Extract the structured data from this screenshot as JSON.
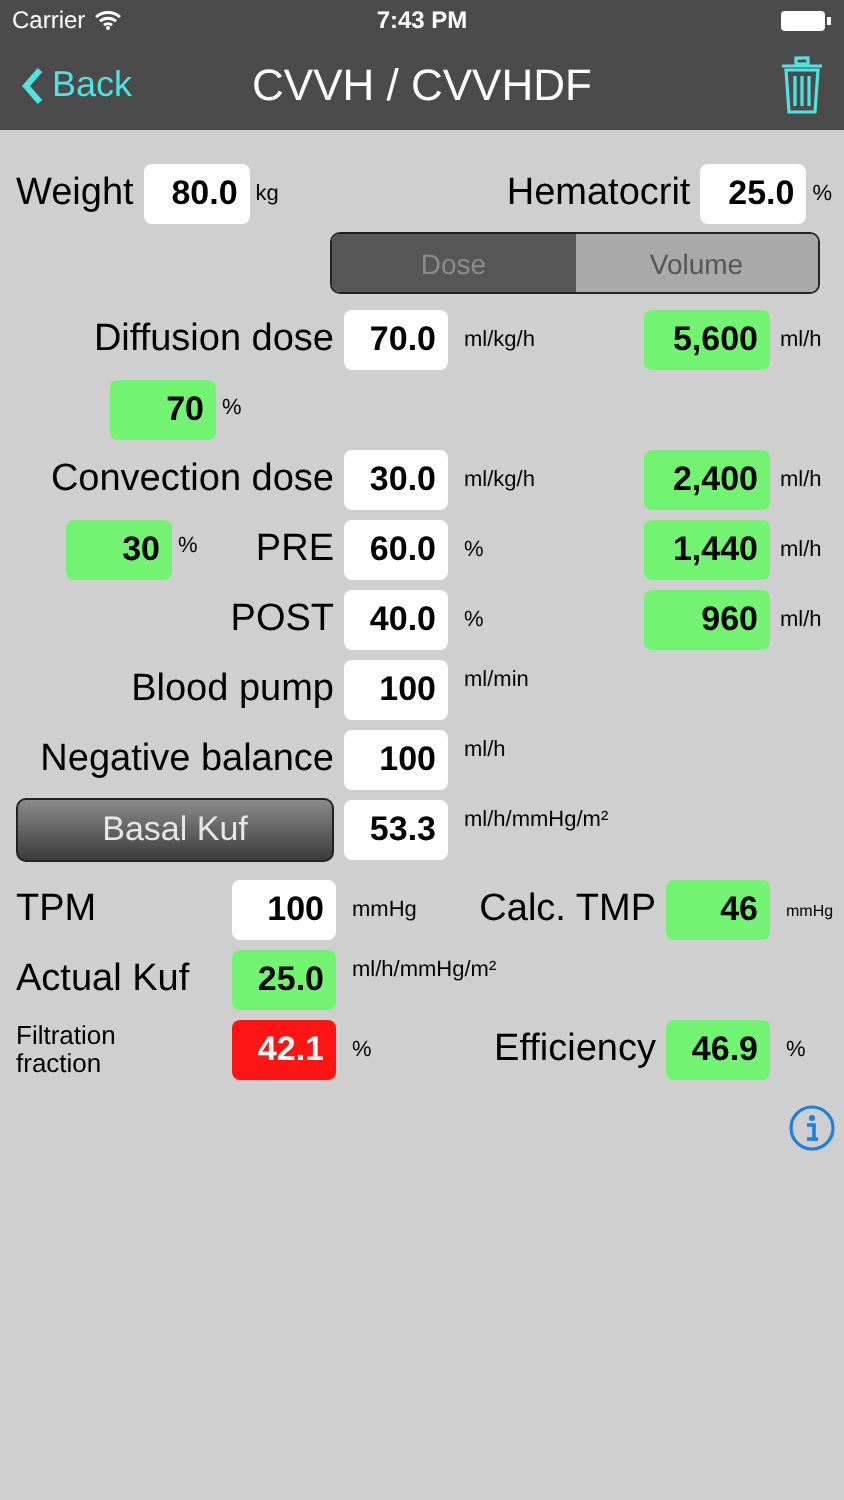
{
  "status_bar": {
    "carrier": "Carrier",
    "time": "7:43 PM"
  },
  "nav": {
    "back": "Back",
    "title": "CVVH / CVVHDF"
  },
  "weight": {
    "label": "Weight",
    "field": {
      "value": "80.0",
      "kind": "input"
    },
    "unit": "kg"
  },
  "hematocrit": {
    "label": "Hematocrit",
    "field": {
      "value": "25.0",
      "kind": "input"
    },
    "unit": "%"
  },
  "mode_toggle": [
    {
      "label": "Dose",
      "selected": true
    },
    {
      "label": "Volume",
      "selected": false
    }
  ],
  "diffusion": {
    "label": "Diffusion dose",
    "field": {
      "value": "70.0",
      "kind": "input"
    },
    "unit": "ml/kg/h",
    "flow": {
      "value": "5,600",
      "kind": "result"
    },
    "flow_unit": "ml/h",
    "share": {
      "value": "70",
      "kind": "result"
    },
    "share_unit": "%"
  },
  "convection": {
    "label": "Convection dose",
    "field": {
      "value": "30.0",
      "kind": "input"
    },
    "unit": "ml/kg/h",
    "flow": {
      "value": "2,400",
      "kind": "result"
    },
    "flow_unit": "ml/h",
    "share": {
      "value": "30",
      "kind": "result"
    },
    "share_unit": "%"
  },
  "pre": {
    "label": "PRE",
    "field": {
      "value": "60.0",
      "kind": "input"
    },
    "unit": "%",
    "flow": {
      "value": "1,440",
      "kind": "result"
    },
    "flow_unit": "ml/h"
  },
  "post": {
    "label": "POST",
    "field": {
      "value": "40.0",
      "kind": "input"
    },
    "unit": "%",
    "flow": {
      "value": "960",
      "kind": "result"
    },
    "flow_unit": "ml/h"
  },
  "blood_pump": {
    "label": "Blood pump",
    "field": {
      "value": "100",
      "kind": "input"
    },
    "unit": "ml/min"
  },
  "negative_balance": {
    "label": "Negative balance",
    "field": {
      "value": "100",
      "kind": "input"
    },
    "unit": "ml/h"
  },
  "basal_kuf": {
    "button": "Basal Kuf",
    "field": {
      "value": "53.3",
      "kind": "input"
    },
    "unit": "ml/h/mmHg/m²"
  },
  "tpm": {
    "label": "TPM",
    "field": {
      "value": "100",
      "kind": "input"
    },
    "unit": "mmHg"
  },
  "calc_tmp": {
    "label": "Calc. TMP",
    "field": {
      "value": "46",
      "kind": "result"
    },
    "unit": "mmHg"
  },
  "actual_kuf": {
    "label": "Actual Kuf",
    "field": {
      "value": "25.0",
      "kind": "result"
    },
    "unit": "ml/h/mmHg/m²"
  },
  "filtration_fraction": {
    "label": "Filtration fraction",
    "field": {
      "value": "42.1",
      "kind": "alert"
    },
    "unit": "%"
  },
  "efficiency": {
    "label": "Efficiency",
    "field": {
      "value": "46.9",
      "kind": "result"
    },
    "unit": "%"
  }
}
